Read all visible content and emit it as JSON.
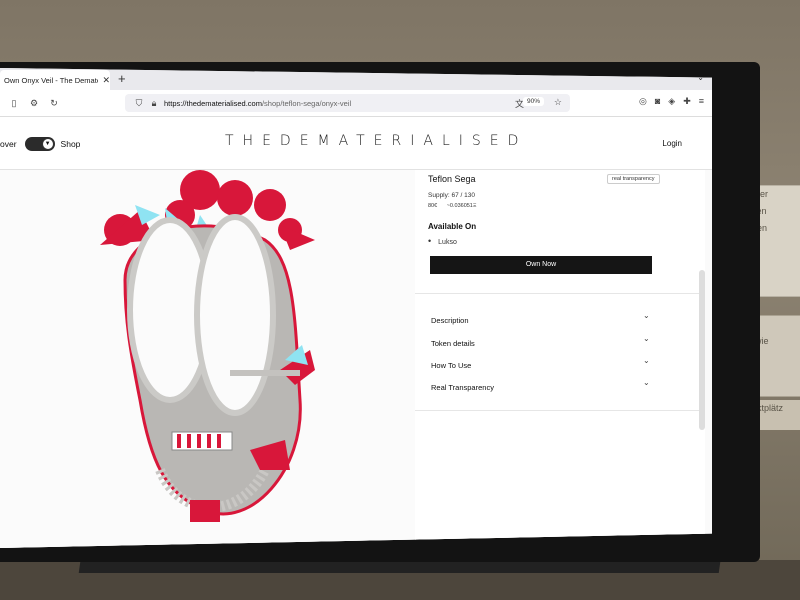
{
  "browser": {
    "tab_title": "Own Onyx Veil - The Dematerial",
    "tab_close": "✕",
    "new_tab": "+",
    "url_domain": "https://thedematerialised.com",
    "url_path": "/shop/teflon-sega/onyx-veil",
    "zoom": "90%"
  },
  "site": {
    "nav_discover": "over",
    "nav_shop": "Shop",
    "logo": "THEDEMATERIALISED",
    "login": "Login"
  },
  "product": {
    "artist": "Teflon Sega",
    "tag": "real transparency",
    "supply": "Supply: 67 / 130",
    "price_label": "80€",
    "price_eth": "~0.036051Ξ",
    "available_on": "Available On",
    "marketplace": "Lukso",
    "own_button": "Own Now"
  },
  "accordion": {
    "items": [
      "Description",
      "Token details",
      "How To Use",
      "Real Transparency"
    ]
  },
  "background": {
    "poster1": [
      "e – der",
      "ditalen",
      "werten"
    ],
    "poster2": [
      "nde",
      "n – wie"
    ],
    "poster3": "arktplätz"
  },
  "colors": {
    "accent_red": "#d8173a",
    "accent_cyan": "#8fe3f2",
    "mask_gray": "#b9b7b4",
    "button_dark": "#151515"
  }
}
